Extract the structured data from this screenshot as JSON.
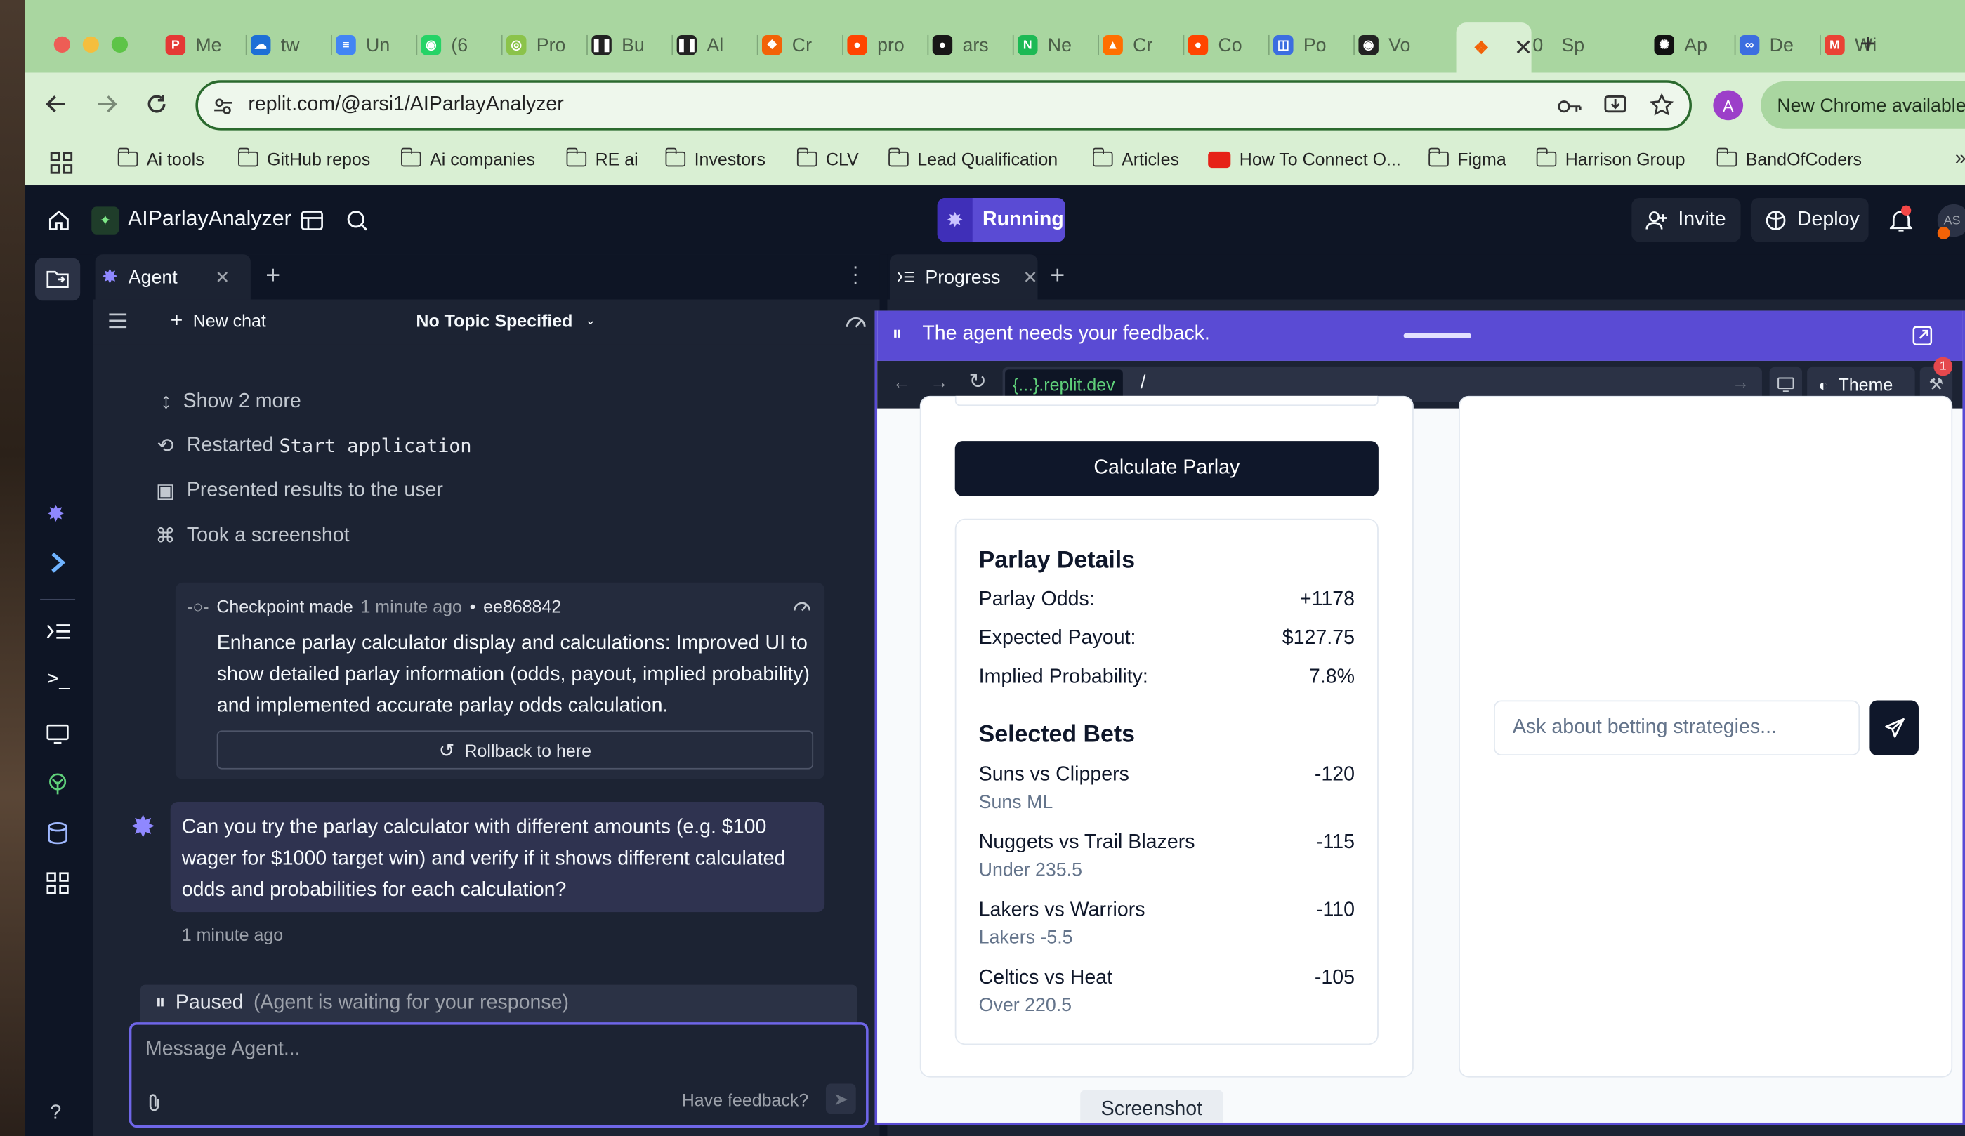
{
  "browser": {
    "tabs": [
      {
        "label": "Me",
        "color": "#e53935",
        "icon": "pinterest-icon"
      },
      {
        "label": "tw",
        "color": "#1d6fd6",
        "icon": "cloud-icon"
      },
      {
        "label": "Un",
        "color": "#4285f4",
        "icon": "docs-icon"
      },
      {
        "label": "(6",
        "color": "#25d366",
        "icon": "whatsapp-icon"
      },
      {
        "label": "Pro",
        "color": "#8bc34a",
        "icon": "circle-icon"
      },
      {
        "label": "Bu",
        "color": "#222222",
        "icon": "pause-icon"
      },
      {
        "label": "Al",
        "color": "#222222",
        "icon": "pause-icon"
      },
      {
        "label": "Cr",
        "color": "#f26207",
        "icon": "replit-icon"
      },
      {
        "label": "pro",
        "color": "#ff4500",
        "icon": "reddit-icon"
      },
      {
        "label": "ars",
        "color": "#181717",
        "icon": "github-icon"
      },
      {
        "label": "Ne",
        "color": "#1db954",
        "icon": "n-icon"
      },
      {
        "label": "Cr",
        "color": "#ff6f00",
        "icon": "fire-icon"
      },
      {
        "label": "Co",
        "color": "#ff4500",
        "icon": "reddit-icon"
      },
      {
        "label": "Po",
        "color": "#3c6ee0",
        "icon": "bot-icon"
      },
      {
        "label": "Vo",
        "color": "#222222",
        "icon": "eye-icon"
      },
      {
        "label": "",
        "color": "#f26207",
        "icon": "replit-icon"
      },
      {
        "label": "Sp",
        "color": "#444444",
        "icon": "zero-icon"
      },
      {
        "label": "Ap",
        "color": "#111111",
        "icon": "openai-icon"
      },
      {
        "label": "De",
        "color": "#3c6ee0",
        "icon": "infinity-icon"
      },
      {
        "label": "Wi",
        "color": "#ea4335",
        "icon": "gmail-icon"
      }
    ],
    "address": "replit.com/@arsi1/AIParlayAnalyzer",
    "profile_initial": "A",
    "update_button": "New Chrome available",
    "sp_prefix": "0",
    "bookmarks": [
      {
        "label": "Ai tools",
        "type": "folder"
      },
      {
        "label": "GitHub repos",
        "type": "folder"
      },
      {
        "label": "Ai companies",
        "type": "folder"
      },
      {
        "label": "RE ai",
        "type": "folder"
      },
      {
        "label": "Investors",
        "type": "folder"
      },
      {
        "label": "CLV",
        "type": "folder"
      },
      {
        "label": "Lead Qualification",
        "type": "folder"
      },
      {
        "label": "Articles",
        "type": "folder"
      },
      {
        "label": "How To Connect O...",
        "type": "youtube"
      },
      {
        "label": "Figma",
        "type": "folder"
      },
      {
        "label": "Harrison Group",
        "type": "folder"
      },
      {
        "label": "BandOfCoders",
        "type": "folder"
      }
    ]
  },
  "replit": {
    "project_name": "AIParlayAnalyzer",
    "status": "Running",
    "invite": "Invite",
    "deploy": "Deploy",
    "avatar_initials": "AS",
    "help": "?"
  },
  "agent": {
    "tab_label": "Agent",
    "new_chat": "New chat",
    "topic": "No Topic Specified",
    "show_more": "Show 2 more",
    "steps": [
      {
        "prefix": "Restarted ",
        "code": "Start application",
        "icon": "restart-icon"
      },
      {
        "prefix": "Presented results to the user",
        "code": "",
        "icon": "present-icon"
      },
      {
        "prefix": "Took a screenshot",
        "code": "",
        "icon": "camera-icon"
      }
    ],
    "checkpoint": {
      "label": "Checkpoint made",
      "time": "1 minute ago",
      "bullet": "•",
      "hash": "ee868842",
      "description": "Enhance parlay calculator display and calculations: Improved UI to show detailed parlay information (odds, payout, implied probability) and implemented accurate parlay odds calculation.",
      "rollback": "Rollback to here"
    },
    "user_message": {
      "text": "Can you try the parlay calculator with different amounts (e.g. $100 wager for $1000 target win) and verify if it shows different calculated odds and probabilities for each calculation?",
      "time": "1 minute ago"
    },
    "paused": {
      "label": "Paused",
      "detail": "(Agent is waiting for your response)"
    },
    "input_placeholder": "Message Agent...",
    "feedback": "Have feedback?"
  },
  "progress": {
    "tab_label": "Progress",
    "banner": "The agent needs your feedback.",
    "url_host": "{...}.replit.dev",
    "url_path": "/",
    "theme": "Theme",
    "badge_count": "1",
    "tooltip": "Screenshot"
  },
  "app": {
    "calculate_button": "Calculate Parlay",
    "details_title": "Parlay Details",
    "details": [
      {
        "label": "Parlay Odds:",
        "value": "+1178"
      },
      {
        "label": "Expected Payout:",
        "value": "$127.75"
      },
      {
        "label": "Implied Probability:",
        "value": "7.8%"
      }
    ],
    "selected_title": "Selected Bets",
    "bets": [
      {
        "game": "Suns vs Clippers",
        "pick": "Suns ML",
        "odds": "-120"
      },
      {
        "game": "Nuggets vs Trail Blazers",
        "pick": "Under 235.5",
        "odds": "-115"
      },
      {
        "game": "Lakers vs Warriors",
        "pick": "Lakers -5.5",
        "odds": "-110"
      },
      {
        "game": "Celtics vs Heat",
        "pick": "Over 220.5",
        "odds": "-105"
      }
    ],
    "chat_placeholder": "Ask about betting strategies..."
  },
  "colors": {
    "accent": "#5a4bd4",
    "running": "#5a4bd4",
    "chrome_green": "#a9d6a0"
  }
}
